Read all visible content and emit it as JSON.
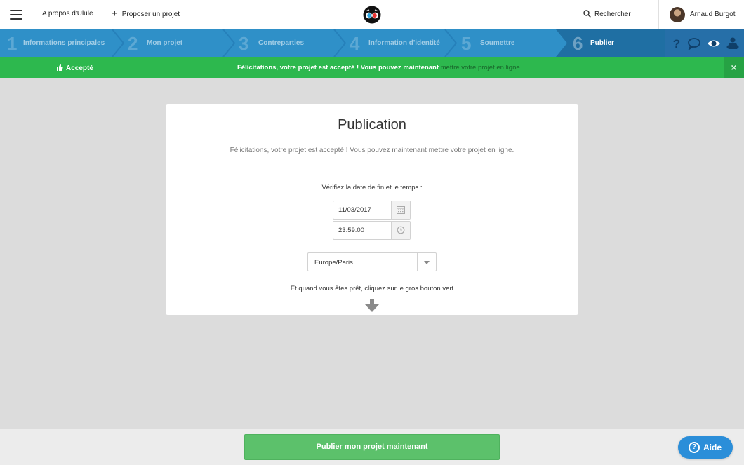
{
  "header": {
    "menu_icon": "hamburger-icon",
    "about_label": "A propos d'Ulule",
    "propose_label": "Proposer un projet",
    "search_label": "Rechercher",
    "user_name": "Arnaud Burgot"
  },
  "steps": {
    "items": [
      {
        "number": "1",
        "label": "Informations principales"
      },
      {
        "number": "2",
        "label": "Mon projet"
      },
      {
        "number": "3",
        "label": "Contreparties"
      },
      {
        "number": "4",
        "label": "Information d'identité"
      },
      {
        "number": "5",
        "label": "Soumettre"
      },
      {
        "number": "6",
        "label": "Publier"
      }
    ],
    "active_index": 6,
    "tools": [
      "help-icon",
      "comment-icon",
      "eye-icon",
      "team-icon"
    ]
  },
  "banner": {
    "badge": "Accepté",
    "message": "Félicitations, votre projet est accepté ! Vous pouvez maintenant ",
    "link": "mettre votre projet en ligne",
    "close": "×"
  },
  "card": {
    "title": "Publication",
    "subtitle": "Félicitations, votre projet est accepté ! Vous pouvez maintenant mettre votre projet en ligne.",
    "verify_label": "Vérifiez la date de fin et le temps :",
    "date_value": "11/03/2017",
    "time_value": "23:59:00",
    "timezone": "Europe/Paris",
    "hint": "Et quand vous êtes prêt, cliquez sur le gros bouton vert"
  },
  "footer": {
    "publish_label": "Publier mon projet maintenant",
    "help_label": "Aide"
  },
  "colors": {
    "steps_bar": "#2f90c8",
    "steps_active": "#1f6fa3",
    "banner": "#2db84e",
    "publish_button": "#5cc16b",
    "help_button": "#2b8ed9"
  }
}
